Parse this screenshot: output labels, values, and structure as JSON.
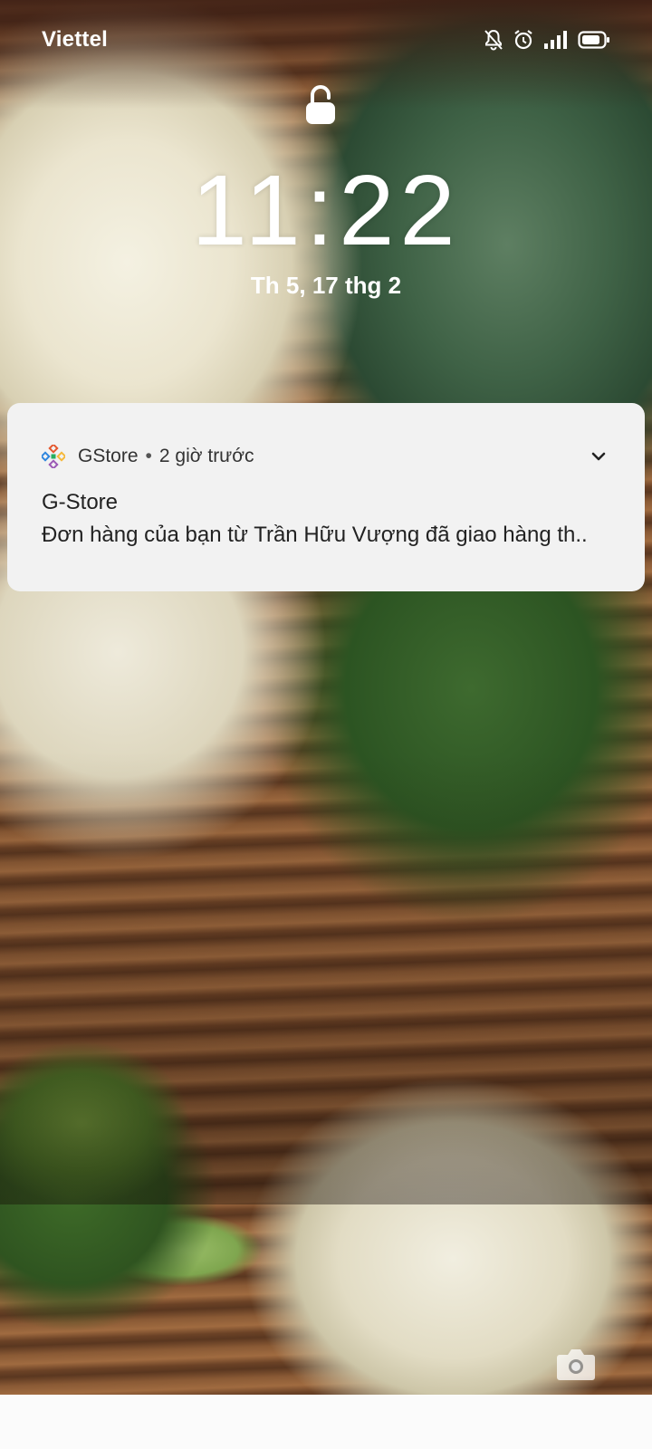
{
  "status_bar": {
    "carrier": "Viettel",
    "icons": [
      "notifications-off-icon",
      "alarm-icon",
      "signal-icon",
      "battery-icon"
    ]
  },
  "lock_screen": {
    "lock_icon": "lock-icon",
    "time": "11:22",
    "date": "Th 5, 17 thg 2"
  },
  "notification": {
    "app_icon": "gstore-logo-icon",
    "app_name": "GStore",
    "separator": "•",
    "time_ago": "2 giờ trước",
    "title": "G-Store",
    "body": "Đơn hàng của bạn từ Trần Hữu Vượng đã giao hàng th..",
    "expand_icon": "chevron-down-icon"
  },
  "shortcuts": {
    "camera_icon": "camera-icon"
  },
  "colors": {
    "card_background": "#f2f2f2",
    "text_primary": "#222222",
    "status_text": "#ffffff"
  }
}
